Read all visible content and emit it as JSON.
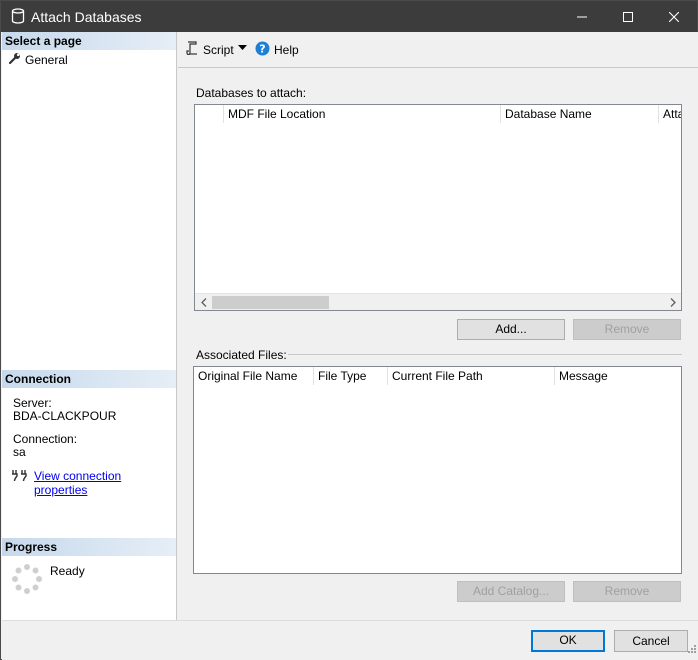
{
  "window": {
    "title": "Attach Databases"
  },
  "left": {
    "select_page_header": "Select a page",
    "pages": [
      {
        "label": "General"
      }
    ],
    "connection_header": "Connection",
    "server_label": "Server:",
    "server_value": "BDA-CLACKPOUR",
    "connection_label": "Connection:",
    "connection_value": "sa",
    "view_props_link": "View connection properties",
    "progress_header": "Progress",
    "progress_status": "Ready"
  },
  "toolbar": {
    "script_label": "Script",
    "help_label": "Help"
  },
  "databases": {
    "label": "Databases to attach:",
    "columns": [
      "",
      "MDF File Location",
      "Database Name",
      "Atta"
    ],
    "add_button": "Add...",
    "remove_button": "Remove"
  },
  "files": {
    "label": "Associated Files:",
    "columns": [
      "Original File Name",
      "File Type",
      "Current File Path",
      "Message"
    ],
    "add_catalog_button": "Add Catalog...",
    "remove_button": "Remove"
  },
  "dialog": {
    "ok_button": "OK",
    "cancel_button": "Cancel"
  },
  "colors": {
    "accent": "#0078d7",
    "titlebar": "#3c3c3c",
    "link": "#0000ee"
  }
}
